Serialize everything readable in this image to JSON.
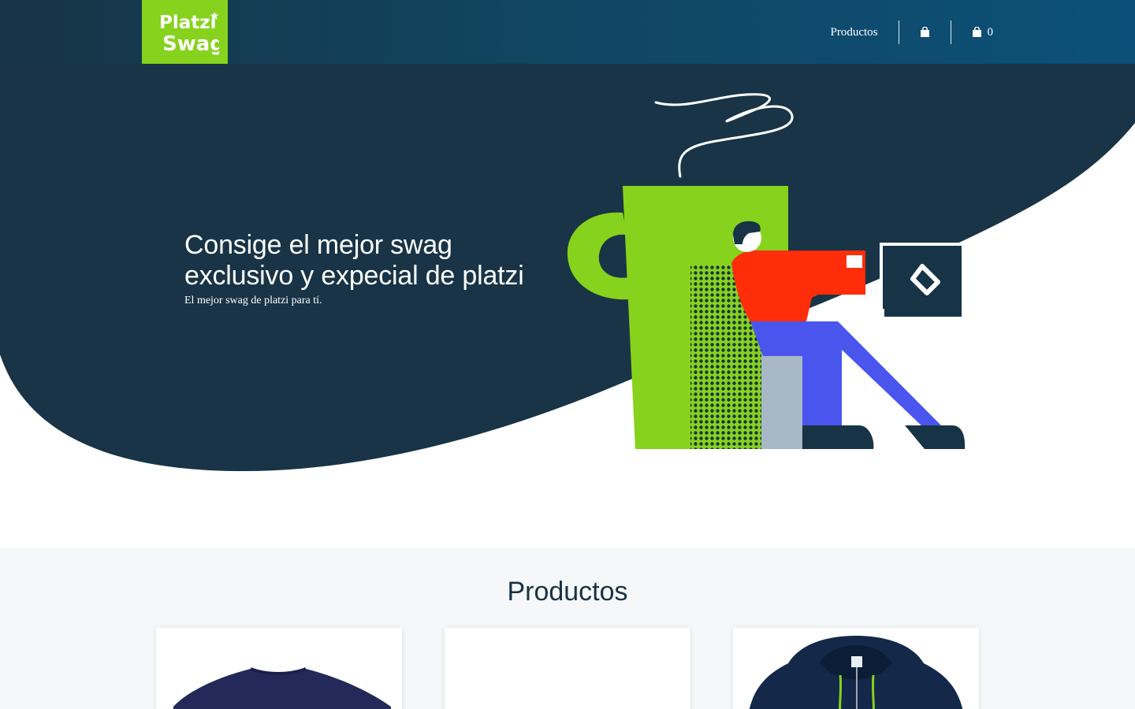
{
  "header": {
    "logo": {
      "line1": "Platzi",
      "line2": "Swag",
      "bg_color": "#86d21c"
    },
    "nav": {
      "products_label": "Productos",
      "bag_icon": "shopping-bag-icon",
      "cart_icon": "shopping-bag-icon",
      "cart_count": "0"
    },
    "gradient": [
      "#173346",
      "#0c5079"
    ]
  },
  "hero": {
    "title": "Consige el mejor swag exclusivo y expecial de platzi",
    "subtitle": "El mejor swag de platzi para tí.",
    "bg_color": "#183446"
  },
  "products": {
    "heading": "Productos",
    "section_bg": "#f5f7f9",
    "items": [
      {
        "image": "navy-tshirt"
      },
      {
        "image": "blank"
      },
      {
        "image": "navy-hoodie"
      }
    ]
  }
}
